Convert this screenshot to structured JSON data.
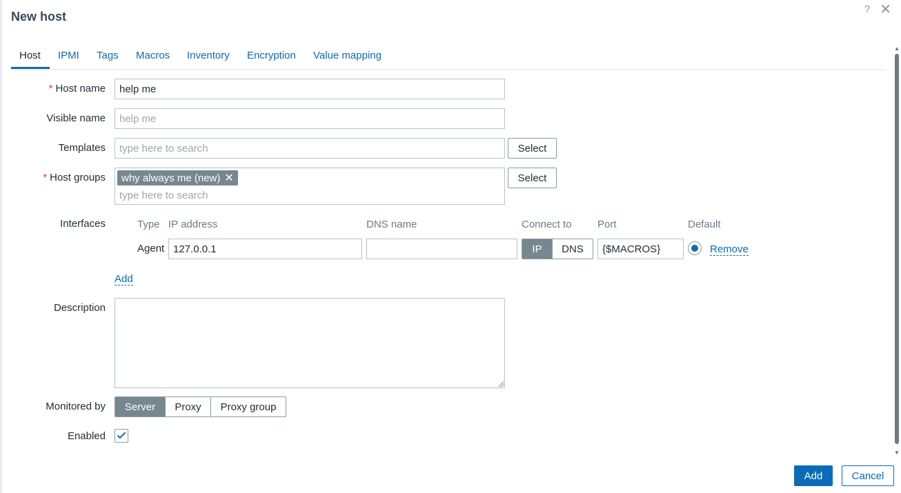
{
  "dialog": {
    "title": "New host",
    "help_icon": "?",
    "close_icon": "✕"
  },
  "tabs": [
    {
      "label": "Host",
      "active": true
    },
    {
      "label": "IPMI"
    },
    {
      "label": "Tags"
    },
    {
      "label": "Macros"
    },
    {
      "label": "Inventory"
    },
    {
      "label": "Encryption"
    },
    {
      "label": "Value mapping"
    }
  ],
  "form": {
    "host_name": {
      "label": "Host name",
      "required_marker": "*",
      "value": "help me"
    },
    "visible_name": {
      "label": "Visible name",
      "placeholder": "help me"
    },
    "templates": {
      "label": "Templates",
      "placeholder": "type here to search",
      "select_label": "Select"
    },
    "host_groups": {
      "label": "Host groups",
      "required_marker": "*",
      "chips": [
        {
          "label": "why always me (new)",
          "remove_icon": "✕"
        }
      ],
      "placeholder": "type here to search",
      "select_label": "Select"
    },
    "interfaces": {
      "label": "Interfaces",
      "columns": {
        "type": "Type",
        "ip": "IP address",
        "dns": "DNS name",
        "connect_to": "Connect to",
        "port": "Port",
        "default": "Default"
      },
      "rows": [
        {
          "type": "Agent",
          "ip": "127.0.0.1",
          "dns": "",
          "connect_options": [
            "IP",
            "DNS"
          ],
          "connect_selected": "IP",
          "port": "{$MACROS}",
          "default": true,
          "remove_label": "Remove"
        }
      ],
      "add_label": "Add"
    },
    "description": {
      "label": "Description",
      "value": ""
    },
    "monitored_by": {
      "label": "Monitored by",
      "options": [
        "Server",
        "Proxy",
        "Proxy group"
      ],
      "selected": "Server"
    },
    "enabled": {
      "label": "Enabled",
      "checked": true
    }
  },
  "footer": {
    "add_label": "Add",
    "cancel_label": "Cancel"
  },
  "colors": {
    "accent": "#0b6bb8",
    "required": "#e03a3a",
    "chip_bg": "#768790"
  }
}
